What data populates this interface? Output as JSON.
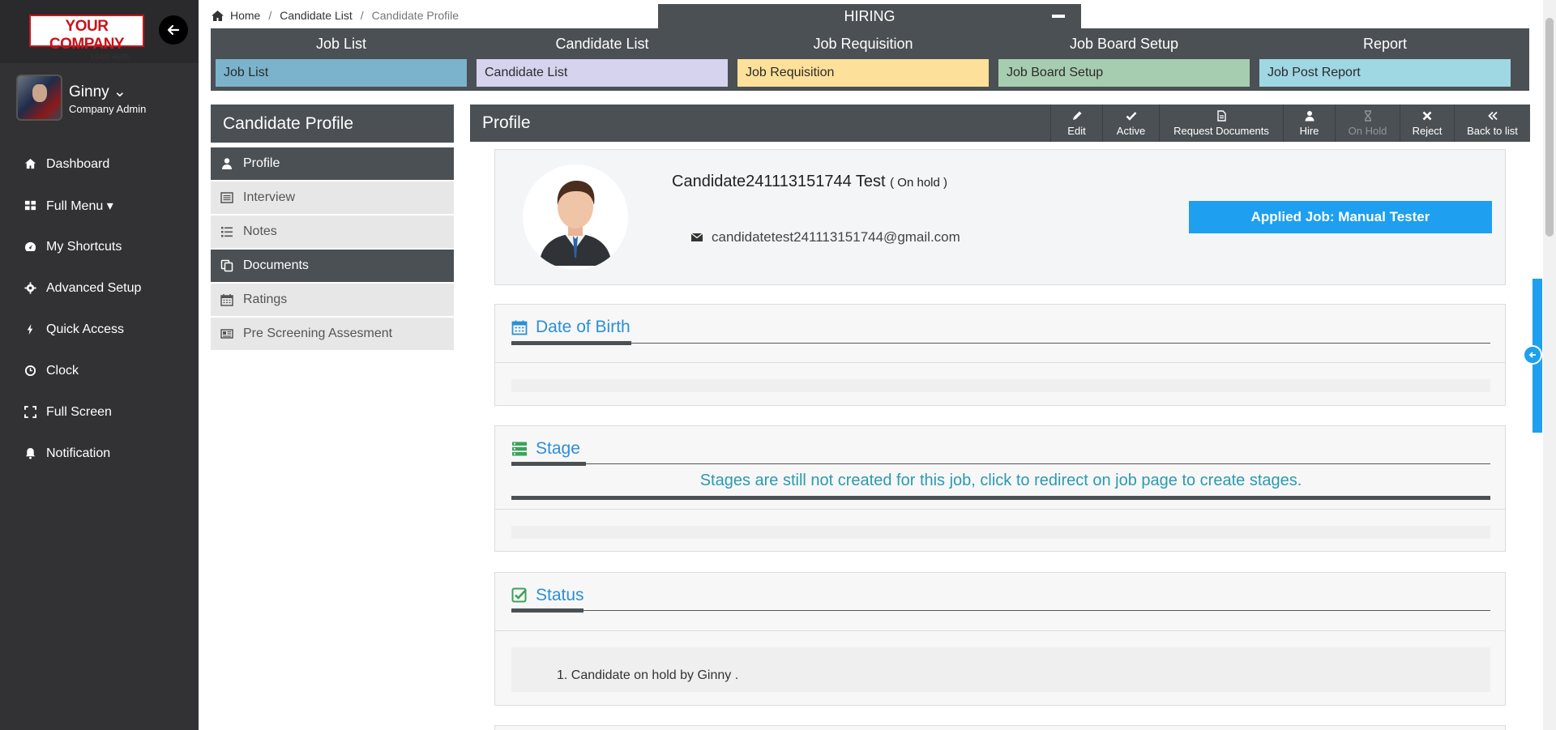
{
  "logo": {
    "line1": "YOUR COMPANY",
    "line2": "LOGO HERE"
  },
  "user": {
    "name": "Ginny ⌄",
    "role": "Company Admin"
  },
  "sidebar": {
    "items": [
      {
        "label": "Dashboard",
        "icon": "home-icon"
      },
      {
        "label": "Full Menu ▾",
        "icon": "grid-icon"
      },
      {
        "label": "My Shortcuts",
        "icon": "gauge-icon"
      },
      {
        "label": "Advanced Setup",
        "icon": "gear-icon"
      },
      {
        "label": "Quick Access",
        "icon": "bolt-icon"
      },
      {
        "label": "Clock",
        "icon": "clock-icon"
      },
      {
        "label": "Full Screen",
        "icon": "expand-icon"
      },
      {
        "label": "Notification",
        "icon": "bell-icon"
      }
    ]
  },
  "breadcrumb": {
    "home": "Home",
    "list": "Candidate List",
    "current": "Candidate Profile"
  },
  "hiring": {
    "title": "HIRING",
    "columns": [
      {
        "title": "Job List",
        "link": "Job List",
        "color": "#7bb3cc"
      },
      {
        "title": "Candidate List",
        "link": "Candidate List",
        "color": "#d6d3ee"
      },
      {
        "title": "Job Requisition",
        "link": "Job Requisition",
        "color": "#fde19a"
      },
      {
        "title": "Job Board Setup",
        "link": "Job Board Setup",
        "color": "#a7cdb0"
      },
      {
        "title": "Report",
        "link": "Job Post Report",
        "color": "#9fd7e3"
      }
    ]
  },
  "candidate_profile": {
    "header": "Candidate Profile",
    "menu": [
      {
        "label": "Profile",
        "active": true
      },
      {
        "label": "Interview",
        "active": false
      },
      {
        "label": "Notes",
        "active": false
      },
      {
        "label": "Documents",
        "active": true
      },
      {
        "label": "Ratings",
        "active": false
      },
      {
        "label": "Pre Screening Assesment",
        "active": false
      }
    ]
  },
  "profile": {
    "title": "Profile",
    "actions": [
      {
        "label": "Edit",
        "icon": "pencil-icon",
        "enabled": true
      },
      {
        "label": "Active",
        "icon": "check-icon",
        "enabled": true
      },
      {
        "label": "Request Documents",
        "icon": "document-icon",
        "enabled": true
      },
      {
        "label": "Hire",
        "icon": "user-icon",
        "enabled": true
      },
      {
        "label": "On Hold",
        "icon": "hourglass-icon",
        "enabled": false
      },
      {
        "label": "Reject",
        "icon": "close-icon",
        "enabled": true
      },
      {
        "label": "Back to list",
        "icon": "double-chevron-left-icon",
        "enabled": true
      }
    ],
    "candidate_name": "Candidate241113151744 Test",
    "status": "( On hold )",
    "email": "candidatetest241113151744@gmail.com",
    "applied_job": "Applied Job: Manual Tester"
  },
  "sections": {
    "dob": {
      "title": "Date of Birth"
    },
    "stage": {
      "title": "Stage",
      "message": "Stages are still not created for this job, click to redirect on job page to create stages."
    },
    "status": {
      "title": "Status",
      "entries": [
        "1. Candidate on hold by Ginny ."
      ]
    }
  },
  "colors": {
    "accent": "#1e9fef",
    "header": "#4a5054",
    "sidebar": "#323234",
    "section_title": "#2b8fd6"
  }
}
